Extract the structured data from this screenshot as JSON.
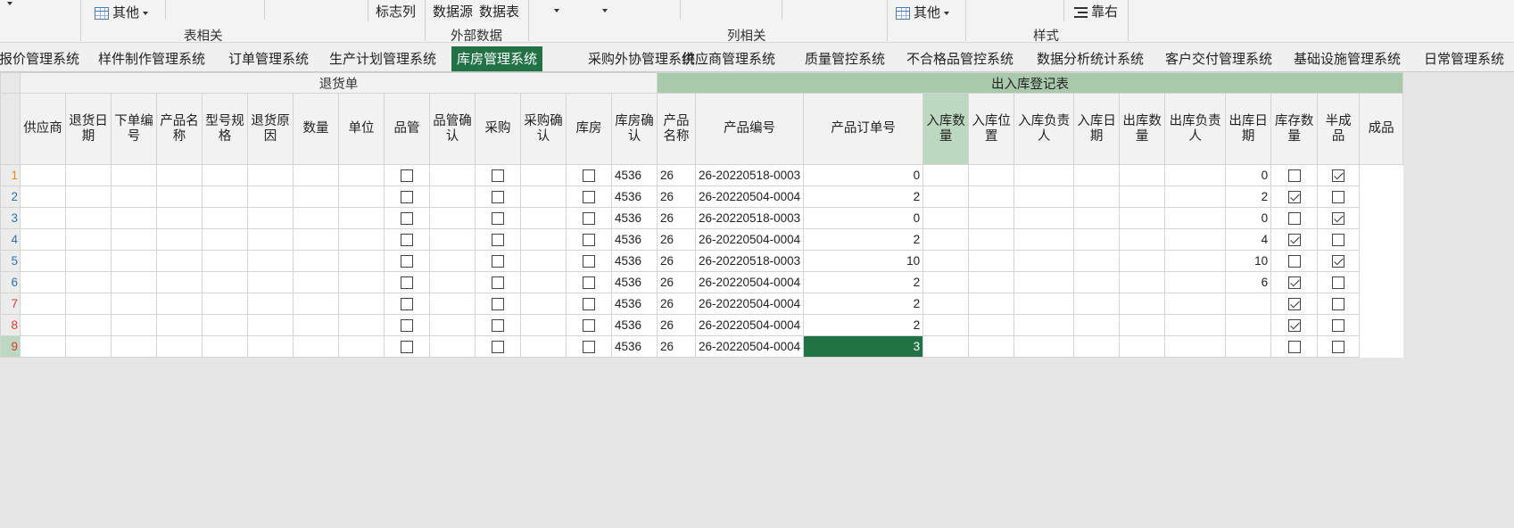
{
  "ribbon": {
    "other_btn_1": "其他",
    "other_btn_2": "其他",
    "flag_col": "标志列",
    "data_source": "数据源",
    "data_table": "数据表",
    "align_right": "靠右",
    "groups": {
      "table_related": "表相关",
      "external_data": "外部数据",
      "column_related": "列相关",
      "style": "样式"
    }
  },
  "tabs": [
    {
      "label": "报价管理系统",
      "active": false
    },
    {
      "label": "样件制作管理系统",
      "active": false
    },
    {
      "label": "订单管理系统",
      "active": false
    },
    {
      "label": "生产计划管理系统",
      "active": false
    },
    {
      "label": "库房管理系统",
      "active": true
    },
    {
      "label": "采购外协管理系统",
      "active": false
    },
    {
      "label": "供应商管理系统",
      "active": false
    },
    {
      "label": "质量管控系统",
      "active": false
    },
    {
      "label": "不合格品管控系统",
      "active": false
    },
    {
      "label": "数据分析统计系统",
      "active": false
    },
    {
      "label": "客户交付管理系统",
      "active": false
    },
    {
      "label": "基础设施管理系统",
      "active": false
    },
    {
      "label": "日常管理系统",
      "active": false
    }
  ],
  "sheet": {
    "group_return": "退货单",
    "group_inout": "出入库登记表",
    "columns": [
      "供应商",
      "退货日期",
      "下单编号",
      "产品名称",
      "型号规格",
      "退货原因",
      "数量",
      "单位",
      "品管",
      "品管确认",
      "采购",
      "采购确认",
      "库房",
      "库房确认",
      "产品名称",
      "产品编号",
      "产品订单号",
      "入库数量",
      "入库位置",
      "入库负责人",
      "入库日期",
      "出库数量",
      "出库负责人",
      "出库日期",
      "库存数量",
      "半成品",
      "成品"
    ],
    "rows": [
      {
        "rn": "1",
        "rn_color": "orange",
        "qc": false,
        "pur": false,
        "wh": false,
        "pname": "4536",
        "pno": "26",
        "order": "26-20220518-0003",
        "in_qty": "0",
        "stock": "0",
        "semi": false,
        "fin": true
      },
      {
        "rn": "2",
        "rn_color": "blue",
        "qc": false,
        "pur": false,
        "wh": false,
        "pname": "4536",
        "pno": "26",
        "order": "26-20220504-0004",
        "in_qty": "2",
        "stock": "2",
        "semi": true,
        "fin": false
      },
      {
        "rn": "3",
        "rn_color": "blue",
        "qc": false,
        "pur": false,
        "wh": false,
        "pname": "4536",
        "pno": "26",
        "order": "26-20220518-0003",
        "in_qty": "0",
        "stock": "0",
        "semi": false,
        "fin": true
      },
      {
        "rn": "4",
        "rn_color": "blue",
        "qc": false,
        "pur": false,
        "wh": false,
        "pname": "4536",
        "pno": "26",
        "order": "26-20220504-0004",
        "in_qty": "2",
        "stock": "4",
        "semi": true,
        "fin": false
      },
      {
        "rn": "5",
        "rn_color": "blue",
        "qc": false,
        "pur": false,
        "wh": false,
        "pname": "4536",
        "pno": "26",
        "order": "26-20220518-0003",
        "in_qty": "10",
        "stock": "10",
        "semi": false,
        "fin": true
      },
      {
        "rn": "6",
        "rn_color": "blue",
        "qc": false,
        "pur": false,
        "wh": false,
        "pname": "4536",
        "pno": "26",
        "order": "26-20220504-0004",
        "in_qty": "2",
        "stock": "6",
        "semi": true,
        "fin": false
      },
      {
        "rn": "7",
        "rn_color": "red",
        "qc": false,
        "pur": false,
        "wh": false,
        "pname": "4536",
        "pno": "26",
        "order": "26-20220504-0004",
        "in_qty": "2",
        "stock": "",
        "semi": true,
        "fin": false
      },
      {
        "rn": "8",
        "rn_color": "red",
        "qc": false,
        "pur": false,
        "wh": false,
        "pname": "4536",
        "pno": "26",
        "order": "26-20220504-0004",
        "in_qty": "2",
        "stock": "",
        "semi": true,
        "fin": false
      },
      {
        "rn": "9",
        "rn_color": "red",
        "qc": false,
        "pur": false,
        "wh": false,
        "pname": "4536",
        "pno": "26",
        "order": "26-20220504-0004",
        "in_qty": "3",
        "stock": "",
        "semi": false,
        "fin": false,
        "selected": true
      }
    ]
  },
  "colors": {
    "accent_green": "#217346",
    "group_header_green": "#a9c9ab",
    "selected_header": "#bdd8c0"
  }
}
